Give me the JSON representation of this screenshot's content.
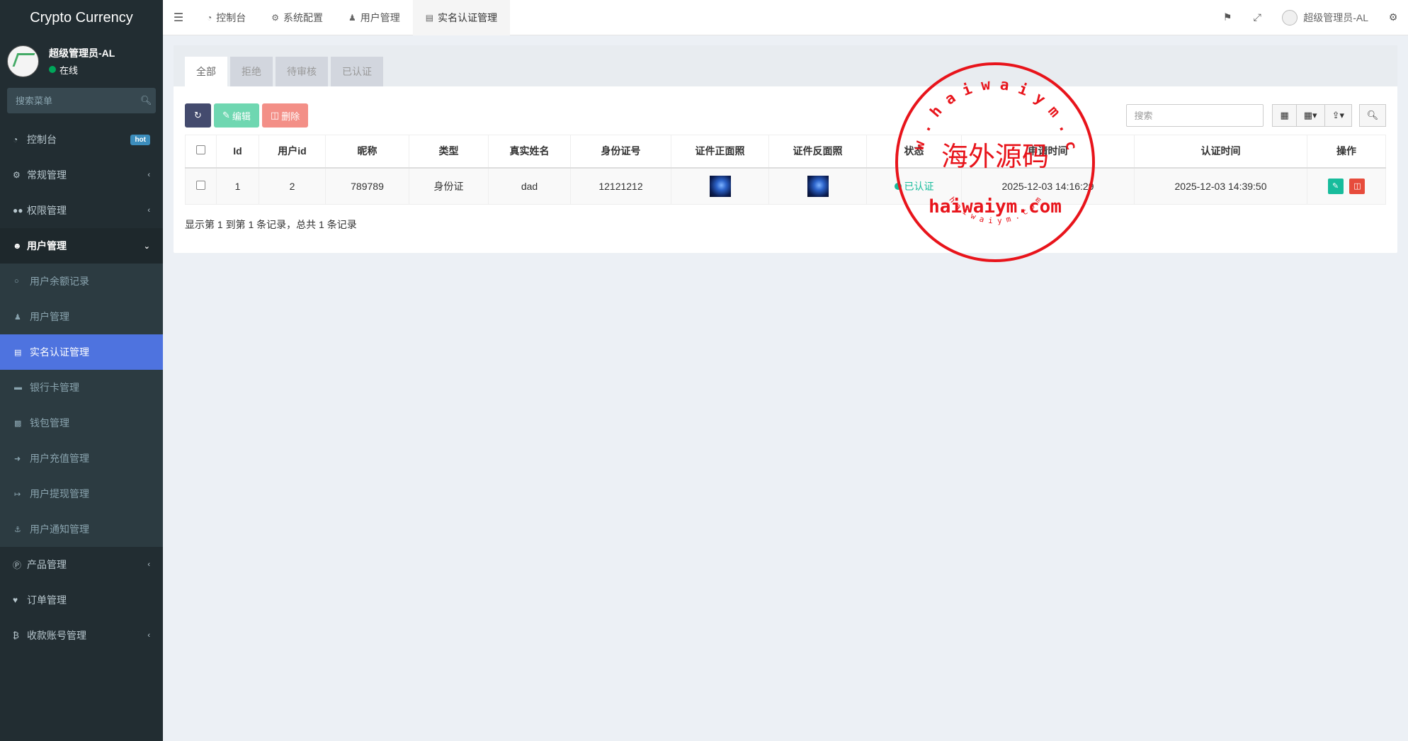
{
  "app": {
    "logo": "Crypto Currency"
  },
  "user": {
    "name": "超级管理员-AL",
    "status": "在线"
  },
  "sidebar": {
    "search_placeholder": "搜索菜单",
    "items": [
      {
        "label": "控制台",
        "icon": "dashboard-icon",
        "badge": "hot"
      },
      {
        "label": "常规管理",
        "icon": "cogs-icon"
      },
      {
        "label": "权限管理",
        "icon": "group-icon"
      },
      {
        "label": "用户管理",
        "icon": "user-circle-icon"
      }
    ],
    "sub_items": [
      {
        "label": "用户余额记录",
        "icon": "circle-o-icon"
      },
      {
        "label": "用户管理",
        "icon": "user-icon"
      },
      {
        "label": "实名认证管理",
        "icon": "id-card-icon"
      },
      {
        "label": "银行卡管理",
        "icon": "credit-card-icon"
      },
      {
        "label": "钱包管理",
        "icon": "money-icon"
      },
      {
        "label": "用户充值管理",
        "icon": "sign-in-icon"
      },
      {
        "label": "用户提现管理",
        "icon": "sign-out-icon"
      },
      {
        "label": "用户通知管理",
        "icon": "anchor-icon"
      }
    ],
    "bottom_items": [
      {
        "label": "产品管理",
        "icon": "product-icon"
      },
      {
        "label": "订单管理",
        "icon": "heartbeat-icon"
      },
      {
        "label": "收款账号管理",
        "icon": "bitcoin-icon"
      }
    ]
  },
  "header": {
    "tabs": [
      {
        "label": "控制台",
        "icon": "dashboard-icon"
      },
      {
        "label": "系统配置",
        "icon": "cog-icon"
      },
      {
        "label": "用户管理",
        "icon": "user-icon"
      },
      {
        "label": "实名认证管理",
        "icon": "id-card-icon"
      }
    ],
    "user_name": "超级管理员-AL"
  },
  "filter_tabs": [
    "全部",
    "拒绝",
    "待审核",
    "已认证"
  ],
  "toolbar": {
    "edit_label": "编辑",
    "delete_label": "删除",
    "search_placeholder": "搜索"
  },
  "table": {
    "columns": [
      "Id",
      "用户id",
      "昵称",
      "类型",
      "真实姓名",
      "身份证号",
      "证件正面照",
      "证件反面照",
      "状态",
      "申请时间",
      "认证时间",
      "操作"
    ],
    "rows": [
      {
        "id": "1",
        "user_id": "2",
        "nickname": "789789",
        "type": "身份证",
        "real_name": "dad",
        "id_number": "12121212",
        "status": "已认证",
        "apply_time": "2025-12-03 14:16:29",
        "verify_time": "2025-12-03 14:39:50"
      }
    ]
  },
  "page_info": "显示第 1 到第 1 条记录，总共 1 条记录",
  "watermark": {
    "top_text": "w w w . h a i w a i y m . c o m",
    "center_text": "海外源码",
    "domain_text": "haiwaiym.com",
    "bottom_text": "h a i w a i y m . c o m",
    "color": "#e8141b"
  }
}
